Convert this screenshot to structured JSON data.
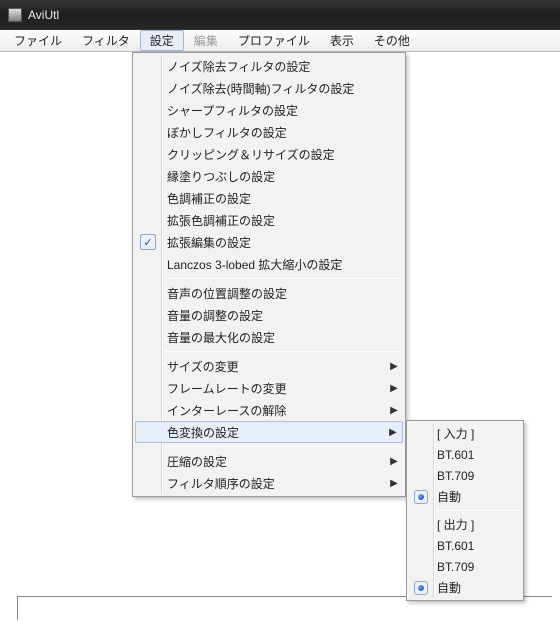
{
  "window": {
    "title": "AviUtl"
  },
  "menubar": {
    "items": [
      {
        "label": "ファイル",
        "enabled": true,
        "active": false
      },
      {
        "label": "フィルタ",
        "enabled": true,
        "active": false
      },
      {
        "label": "設定",
        "enabled": true,
        "active": true
      },
      {
        "label": "編集",
        "enabled": false,
        "active": false
      },
      {
        "label": "プロファイル",
        "enabled": true,
        "active": false
      },
      {
        "label": "表示",
        "enabled": true,
        "active": false
      },
      {
        "label": "その他",
        "enabled": true,
        "active": false
      }
    ]
  },
  "settings_menu": {
    "groups": [
      [
        {
          "label": "ノイズ除去フィルタの設定"
        },
        {
          "label": "ノイズ除去(時間軸)フィルタの設定"
        },
        {
          "label": "シャープフィルタの設定"
        },
        {
          "label": "ぼかしフィルタの設定"
        },
        {
          "label": "クリッピング＆リサイズの設定"
        },
        {
          "label": "縁塗りつぶしの設定"
        },
        {
          "label": "色調補正の設定"
        },
        {
          "label": "拡張色調補正の設定"
        },
        {
          "label": "拡張編集の設定",
          "checked": true
        },
        {
          "label": "Lanczos 3-lobed 拡大縮小の設定"
        }
      ],
      [
        {
          "label": "音声の位置調整の設定"
        },
        {
          "label": "音量の調整の設定"
        },
        {
          "label": "音量の最大化の設定"
        }
      ],
      [
        {
          "label": "サイズの変更",
          "submenu": true
        },
        {
          "label": "フレームレートの変更",
          "submenu": true
        },
        {
          "label": "インターレースの解除",
          "submenu": true
        },
        {
          "label": "色変換の設定",
          "submenu": true,
          "highlight": true
        }
      ],
      [
        {
          "label": "圧縮の設定",
          "submenu": true
        },
        {
          "label": "フィルタ順序の設定",
          "submenu": true
        }
      ]
    ]
  },
  "color_submenu": {
    "groups": [
      [
        {
          "label": "[ 入力 ]"
        },
        {
          "label": "BT.601"
        },
        {
          "label": "BT.709"
        },
        {
          "label": "自動",
          "radio": true
        }
      ],
      [
        {
          "label": "[ 出力 ]"
        },
        {
          "label": "BT.601"
        },
        {
          "label": "BT.709"
        },
        {
          "label": "自動",
          "radio": true
        }
      ]
    ]
  }
}
